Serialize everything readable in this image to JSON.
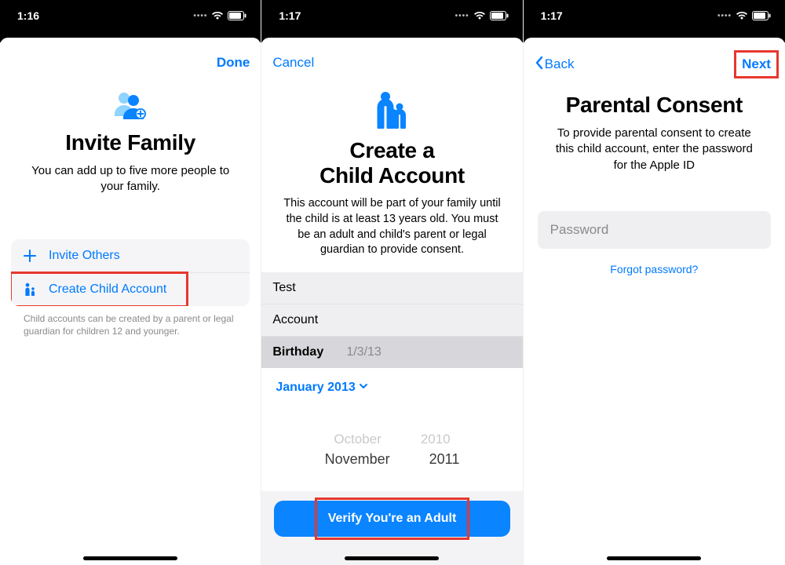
{
  "screen1": {
    "time": "1:16",
    "nav_done": "Done",
    "title": "Invite Family",
    "subtitle": "You can add up to five more people to your family.",
    "rows": {
      "invite": "Invite Others",
      "child": "Create Child Account"
    },
    "footnote": "Child accounts can be created by a parent or legal guardian for children 12 and younger."
  },
  "screen2": {
    "time": "1:17",
    "nav_cancel": "Cancel",
    "title_line1": "Create a",
    "title_line2": "Child Account",
    "subtitle": "This account will be part of your family until the child is at least 13 years old. You must be an adult and child's parent or legal guardian to provide consent.",
    "first_name": "Test",
    "last_name": "Account",
    "birthday_label": "Birthday",
    "birthday_value": "1/3/13",
    "month_picker": "January 2013",
    "wheel_prev_month": "October",
    "wheel_prev_year": "2010",
    "wheel_month": "November",
    "wheel_year": "2011",
    "verify_button": "Verify You're an Adult"
  },
  "screen3": {
    "time": "1:17",
    "nav_back": "Back",
    "nav_next": "Next",
    "title": "Parental Consent",
    "subtitle": "To provide parental consent to create this child account, enter the password for the Apple ID",
    "password_placeholder": "Password",
    "forgot": "Forgot password?"
  }
}
